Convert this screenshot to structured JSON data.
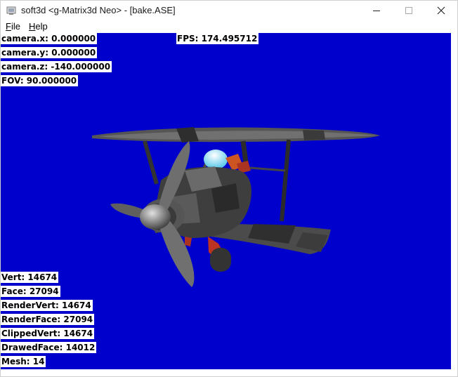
{
  "window": {
    "title": "soft3d <g-Matrix3d Neo> - [bake.ASE]",
    "icon": "app-icon",
    "controls": {
      "minimize": "minimize-icon",
      "maximize": "maximize-icon",
      "close": "close-icon"
    }
  },
  "menu": {
    "file": "File",
    "help": "Help"
  },
  "camera": {
    "x": "camera.x: 0.000000",
    "y": "camera.y: 0.000000",
    "z": "camera.z: -140.000000",
    "fov": "FOV: 90.000000"
  },
  "fps": "FPS: 174.495712",
  "stats": {
    "vert": "Vert: 14674",
    "face": "Face: 27094",
    "render_vert": "RenderVert: 14674",
    "render_face": "RenderFace: 27094",
    "clipped_vert": "ClippedVert: 14674",
    "drawed_face": "DrawedFace: 14012",
    "mesh": "Mesh: 14"
  },
  "colors": {
    "viewport_bg": "#0000cc",
    "hud_bg": "#ffffff"
  }
}
